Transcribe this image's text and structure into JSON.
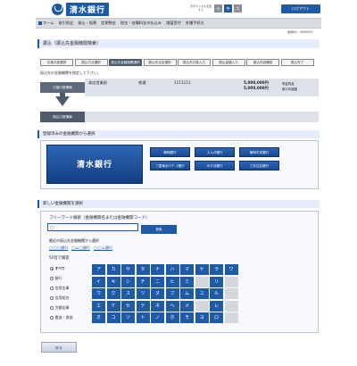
{
  "brand": {
    "name": "清水銀行",
    "color": "#1f5aa6"
  },
  "header": {
    "font_size_label": "文字サイズを変更する",
    "size_buttons": [
      "小",
      "中",
      "大"
    ],
    "logout": "ログアウト"
  },
  "nav": {
    "items": [
      "ホーム",
      "取引照会",
      "振込・振替",
      "定期預金",
      "税金・各種料金の払込み",
      "諸届受付",
      "各種手続き"
    ]
  },
  "screen_id": "画面ID：BKM005",
  "page_title": "振込（振込先金融機関検索）",
  "steps": [
    "引落口座選択",
    "振込方法選択",
    "振込先金融機関選択",
    "振込先支店選択",
    "振込先口座入力",
    "振込金額入力",
    "振込内容確認",
    "振込完了"
  ],
  "instruction": "振込先の金融機関を指定して下さい。",
  "flow": {
    "from_label": "引落口座情報",
    "to_label": "振込口座情報",
    "branch": "本店営業部",
    "type": "普通",
    "account": "1111111",
    "amount1": "5,000,000円",
    "amount1_note": "現金残高",
    "amount2": "5,000,000円",
    "amount2_note": "取引可能額"
  },
  "registered": {
    "header": "登録済みの金融機関から選択",
    "main": "清水銀行",
    "banks": [
      "静岡銀行",
      "スルガ銀行",
      "静岡中央銀行",
      "三菱東京ＵＦＪ銀行",
      "みずほ銀行",
      "三井住友銀行"
    ]
  },
  "new_bank": {
    "header": "新しい金融機関を選択",
    "freeword_label": "フリーワード検索（金融機関名または金融機関コード）",
    "freeword_value": "◯",
    "search_button": "検索",
    "recent_label": "最近の振込先金融機関から選択",
    "recent": [
      "◯◯◯銀行",
      "◯ム◯銀行",
      "◯◯ム銀行"
    ],
    "kana_label": "50音で検索",
    "filters": [
      "すべて",
      "銀行",
      "信用金庫",
      "信用組合",
      "労働金庫",
      "農協・漁協"
    ],
    "selected_filter": "すべて",
    "kana_rows": [
      [
        "ア",
        "カ",
        "サ",
        "タ",
        "ナ",
        "ハ",
        "マ",
        "ヤ",
        "ラ",
        "ワ"
      ],
      [
        "イ",
        "キ",
        "シ",
        "チ",
        "ニ",
        "ヒ",
        "ミ",
        "",
        "リ",
        ""
      ],
      [
        "ウ",
        "ク",
        "ス",
        "ツ",
        "ヌ",
        "フ",
        "ム",
        "ユ",
        "ル",
        ""
      ],
      [
        "エ",
        "ケ",
        "セ",
        "テ",
        "ネ",
        "ヘ",
        "メ",
        "",
        "レ",
        ""
      ],
      [
        "オ",
        "コ",
        "ソ",
        "ト",
        "ノ",
        "ホ",
        "モ",
        "ヨ",
        "ロ",
        ""
      ]
    ]
  },
  "back_button": "戻る"
}
